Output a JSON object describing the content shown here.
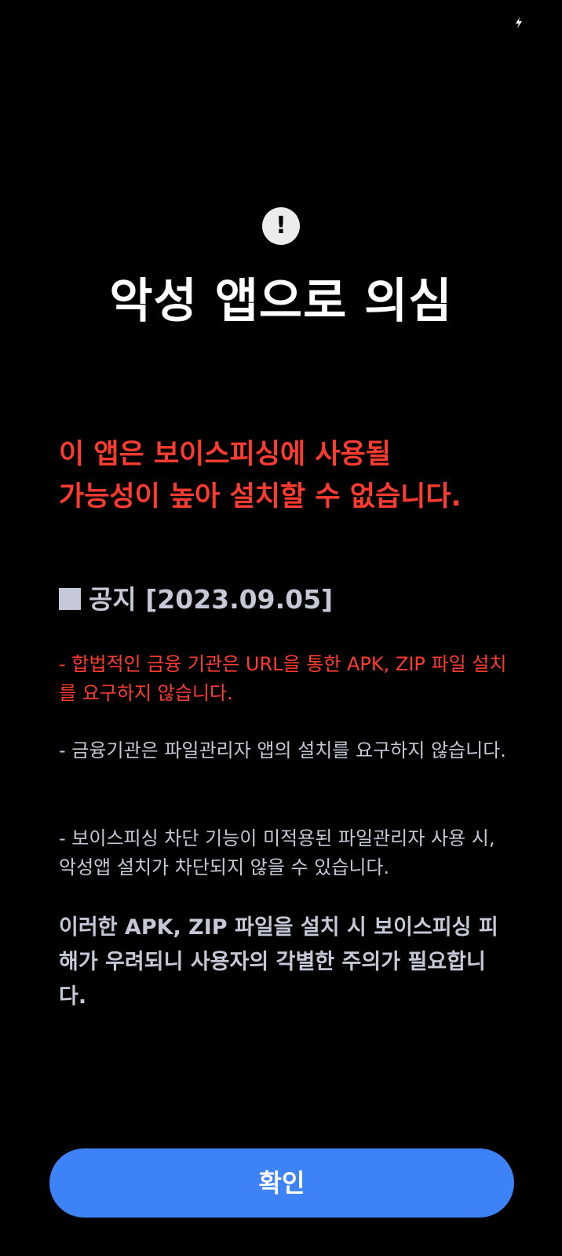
{
  "status_bar": {
    "icon": "charging-bolt-icon"
  },
  "dialog": {
    "icon": "exclamation-icon",
    "title": "악성 앱으로 의심",
    "warning_line1": "이 앱은 보이스피싱에 사용될",
    "warning_line2": "가능성이 높아 설치할 수 없습니다.",
    "notice": {
      "heading": "공지 [2023.09.05]",
      "items": [
        "- 합법적인 금융 기관은 URL을 통한 APK, ZIP 파일 설치를 요구하지 않습니다.",
        "- 금융기관은 파일관리자 앱의 설치를 요구하지 않습니다.",
        "- 보이스피싱 차단 기능이 미적용된 파일관리자 사용 시, 악성앱 설치가 차단되지 않을 수 있습니다."
      ],
      "closing": "이러한 APK, ZIP 파일을 설치 시 보이스피싱 피해가 우려되니 사용자의 각별한 주의가 필요합니다."
    },
    "confirm_label": "확인"
  },
  "colors": {
    "background": "#000000",
    "title": "#ffffff",
    "warning_red": "#ff3b30",
    "notice_text": "#c5c8d6",
    "button_blue": "#3d82f6"
  }
}
